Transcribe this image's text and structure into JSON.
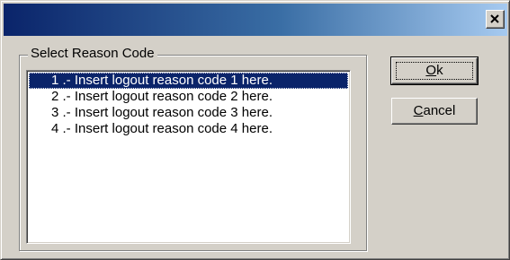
{
  "dialog": {
    "title": "",
    "close_icon": "close-x-icon"
  },
  "group": {
    "label": "Select Reason Code"
  },
  "list": {
    "items": [
      {
        "label": "1 .- Insert logout reason code 1 here.",
        "selected": true
      },
      {
        "label": "2 .- Insert logout reason code 2 here.",
        "selected": false
      },
      {
        "label": "3 .- Insert logout reason code 3 here.",
        "selected": false
      },
      {
        "label": "4 .- Insert logout reason code 4 here.",
        "selected": false
      }
    ]
  },
  "buttons": {
    "ok": {
      "mnemonic": "O",
      "rest": "k"
    },
    "cancel": {
      "mnemonic": "C",
      "rest": "ancel"
    }
  },
  "colors": {
    "title_gradient_start": "#0a246a",
    "title_gradient_end": "#a6caf0",
    "selection": "#0a246a",
    "face": "#d4d0c8"
  }
}
